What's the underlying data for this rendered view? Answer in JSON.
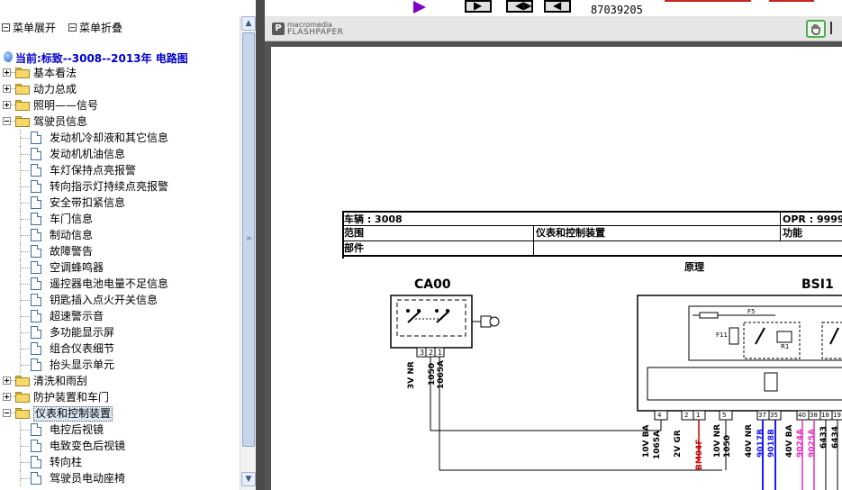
{
  "tree": {
    "toolbar": {
      "expand_label": "菜单展开",
      "collapse_label": "菜单折叠"
    },
    "current": "当前:标致--3008--2013年  电路图",
    "items": [
      {
        "label": "基本看法",
        "level": 0,
        "type": "folder",
        "expanded": false
      },
      {
        "label": "动力总成",
        "level": 0,
        "type": "folder",
        "expanded": false
      },
      {
        "label": "照明——信号",
        "level": 0,
        "type": "folder",
        "expanded": false
      },
      {
        "label": "驾驶员信息",
        "level": 0,
        "type": "folder",
        "expanded": true
      },
      {
        "label": "发动机冷却液和其它信息",
        "level": 1,
        "type": "doc"
      },
      {
        "label": "发动机机油信息",
        "level": 1,
        "type": "doc"
      },
      {
        "label": "车灯保持点亮报警",
        "level": 1,
        "type": "doc"
      },
      {
        "label": "转向指示灯持续点亮报警",
        "level": 1,
        "type": "doc"
      },
      {
        "label": "安全带扣紧信息",
        "level": 1,
        "type": "doc"
      },
      {
        "label": "车门信息",
        "level": 1,
        "type": "doc"
      },
      {
        "label": "制动信息",
        "level": 1,
        "type": "doc"
      },
      {
        "label": "故障警告",
        "level": 1,
        "type": "doc"
      },
      {
        "label": "空调蜂鸣器",
        "level": 1,
        "type": "doc"
      },
      {
        "label": "遥控器电池电量不足信息",
        "level": 1,
        "type": "doc"
      },
      {
        "label": "钥匙插入点火开关信息",
        "level": 1,
        "type": "doc"
      },
      {
        "label": "超速警示音",
        "level": 1,
        "type": "doc"
      },
      {
        "label": "多功能显示屏",
        "level": 1,
        "type": "doc"
      },
      {
        "label": "组合仪表细节",
        "level": 1,
        "type": "doc"
      },
      {
        "label": "抬头显示单元",
        "level": 1,
        "type": "doc"
      },
      {
        "label": "清洗和雨刮",
        "level": 0,
        "type": "folder",
        "expanded": false
      },
      {
        "label": "防护装置和车门",
        "level": 0,
        "type": "folder",
        "expanded": false
      },
      {
        "label": "仪表和控制装置",
        "level": 0,
        "type": "folder",
        "expanded": true,
        "selected": true
      },
      {
        "label": "电控后视镜",
        "level": 1,
        "type": "doc"
      },
      {
        "label": "电致变色后视镜",
        "level": 1,
        "type": "doc"
      },
      {
        "label": "转向柱",
        "level": 1,
        "type": "doc"
      },
      {
        "label": "驾驶员电动座椅",
        "level": 1,
        "type": "doc"
      }
    ]
  },
  "topstrip": {
    "number": "87039205"
  },
  "viewer": {
    "logo_small": "macromedia",
    "logo_big": "FLASHPAPER",
    "icons": {
      "hand": "hand-tool-icon",
      "logo": "flashpaper-logo-icon"
    }
  },
  "document": {
    "header": {
      "vehicle": "车辆 : 3008",
      "opr": "OPR : 9999",
      "scope": "范围",
      "system": "仪表和控制装置",
      "function": "功能",
      "part": "部件",
      "principle": "原理"
    },
    "components": {
      "ca00": "CA00",
      "bsi1": "BSI1"
    },
    "ca00_pins": [
      "3",
      "2",
      "1"
    ],
    "ca00_wires": [
      "3V NR",
      "1050",
      "1065A"
    ],
    "bsi_fuses": {
      "f5": "F5",
      "f11": "F11",
      "r1": "R1"
    },
    "bsi_connectors": [
      {
        "conn": "10V BA",
        "pin": "4",
        "wire": "1065A"
      },
      {
        "conn": "2V GR",
        "pin": "2",
        "wire": "BM04F",
        "pin2": "1"
      },
      {
        "conn": "10V NR",
        "pin": "5",
        "wire": "1050"
      },
      {
        "conn": "40V NR",
        "pin": "37",
        "wire": "9017B",
        "pin2": "35",
        "wire2": "9018B"
      },
      {
        "conn": "40V BA",
        "pin": "40",
        "wire": "9024A",
        "pin2": "38",
        "wire2": "9025A",
        "pin3": "18",
        "wire3": "6433",
        "pin4": "19",
        "wire4": "6434"
      }
    ],
    "colors": {
      "blue_wire": "#1a1aff",
      "magenta_wire": "#e030c0",
      "red_wire": "#cc0000"
    }
  }
}
